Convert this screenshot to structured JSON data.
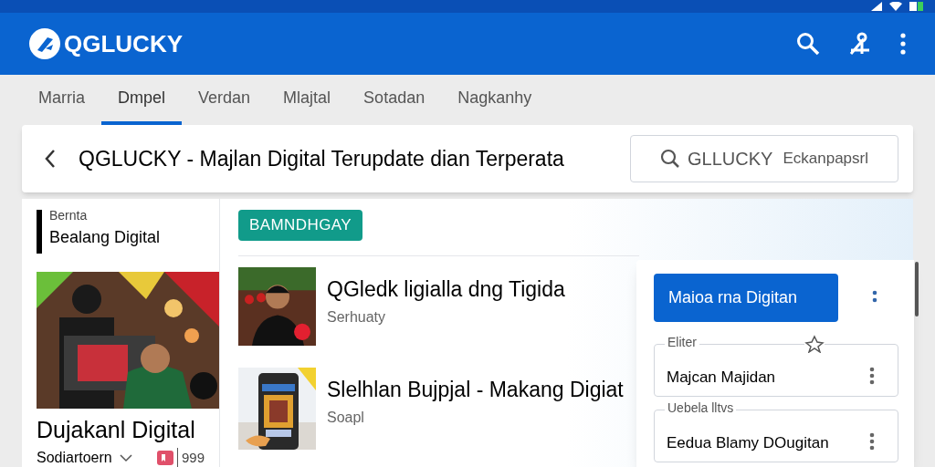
{
  "app_bar": {
    "title": "QGLUCKY"
  },
  "tabs": [
    {
      "label": "Marria",
      "selected": false
    },
    {
      "label": "Dmpel",
      "selected": true
    },
    {
      "label": "Verdan",
      "selected": false
    },
    {
      "label": "Mlajtal",
      "selected": false
    },
    {
      "label": "Sotadan",
      "selected": false
    },
    {
      "label": "Nagkanhy",
      "selected": false
    }
  ],
  "header": {
    "title": "QGLUCKY - Majlan Digital Terupdate dian Terperata",
    "search": {
      "value": "GLLUCKY",
      "trailing": "Eckanpapsrl"
    }
  },
  "sidebar": {
    "overline": "Bernta",
    "heading": "Bealang Digital",
    "feature": {
      "kind": "picture",
      "title": "Dujakanl Digital",
      "author": "Sodiartoern",
      "count": "999"
    }
  },
  "badge": "BAMNDHGAY",
  "articles": [
    {
      "kind": "picture",
      "title": "QGledk ligialla dng Tigida",
      "subtitle": "Serhuaty"
    },
    {
      "kind": "picture",
      "title": "Slelhlan Bujpjal - Makang Digiat",
      "subtitle": "Soapl"
    }
  ],
  "panel": {
    "button": "Maioa rna Digitan",
    "fields": [
      {
        "label": "Eliter",
        "value": "Majcan Majidan"
      },
      {
        "label": "Uebela lltvs",
        "value": "Eedua Blamy DOugitan"
      }
    ]
  }
}
